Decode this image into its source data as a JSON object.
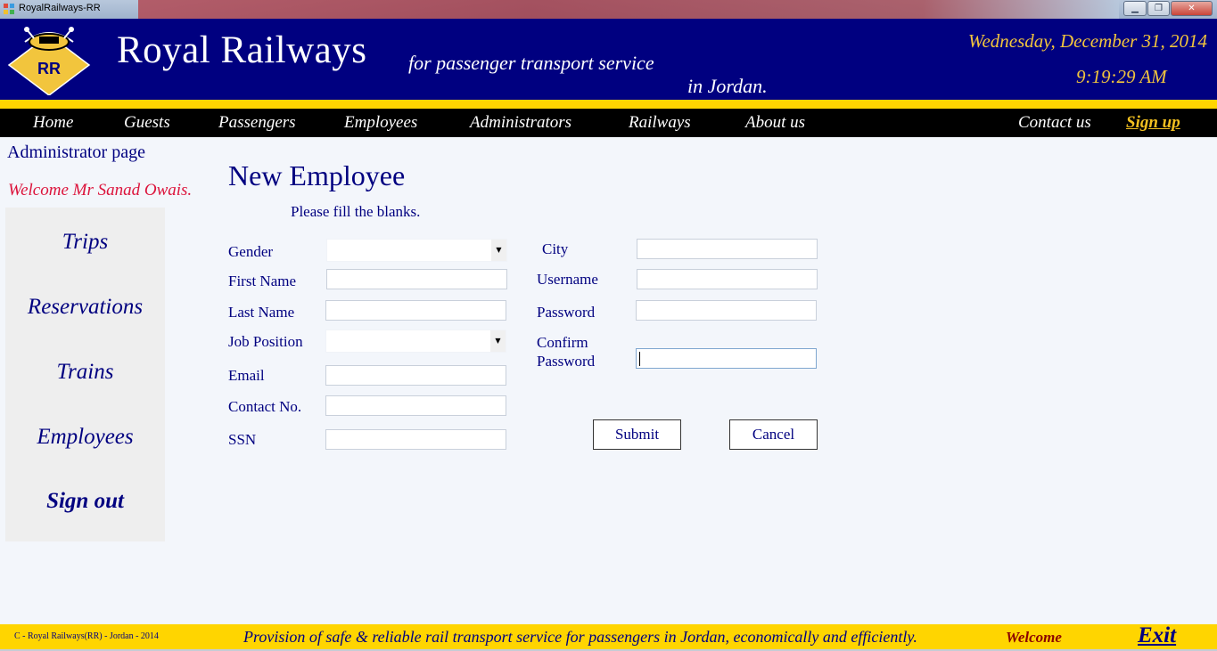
{
  "window": {
    "title": "RoyalRailways-RR",
    "min_glyph": "▁",
    "max_glyph": "❐",
    "close_glyph": "✕"
  },
  "header": {
    "logo_text": "RR",
    "brand": "Royal Railways",
    "tagline_1": "for passenger transport service",
    "tagline_2": "in Jordan.",
    "date": "Wednesday, December 31, 2014",
    "time": "9:19:29 AM",
    "colors": {
      "navy": "#000080",
      "gold": "#ffd500",
      "date": "#f2c53d"
    }
  },
  "nav": {
    "home": "Home",
    "guests": "Guests",
    "passengers": "Passengers",
    "employees": "Employees",
    "administrators": "Administrators",
    "railways": "Railways",
    "about": "About us",
    "contact": "Contact us",
    "signup": "Sign up"
  },
  "left": {
    "admin_page": "Administrator page",
    "welcome": "Welcome Mr Sanad Owais.",
    "menu": {
      "trips": "Trips",
      "reservations": "Reservations",
      "trains": "Trains",
      "employees": "Employees",
      "signout": "Sign out"
    }
  },
  "form": {
    "title": "New Employee",
    "subtitle": "Please fill the blanks.",
    "labels": {
      "gender": "Gender",
      "first_name": "First Name",
      "last_name": "Last Name",
      "job_position": "Job Position",
      "email": "Email",
      "contact_no": "Contact No.",
      "ssn": "SSN",
      "city": "City",
      "username": "Username",
      "password": "Password",
      "confirm_1": "Confirm",
      "confirm_2": "Password"
    },
    "values": {
      "gender": "",
      "first_name": "",
      "last_name": "",
      "job_position": "",
      "email": "",
      "contact_no": "",
      "ssn": "",
      "city": "",
      "username": "",
      "password": "",
      "confirm_password": ""
    },
    "submit": "Submit",
    "cancel": "Cancel"
  },
  "footer": {
    "copyright": "C - Royal Railways(RR) - Jordan - 2014",
    "slogan": "Provision of safe & reliable rail transport service for passengers in Jordan, economically and efficiently.",
    "welcome": "Welcome",
    "exit": "Exit"
  }
}
